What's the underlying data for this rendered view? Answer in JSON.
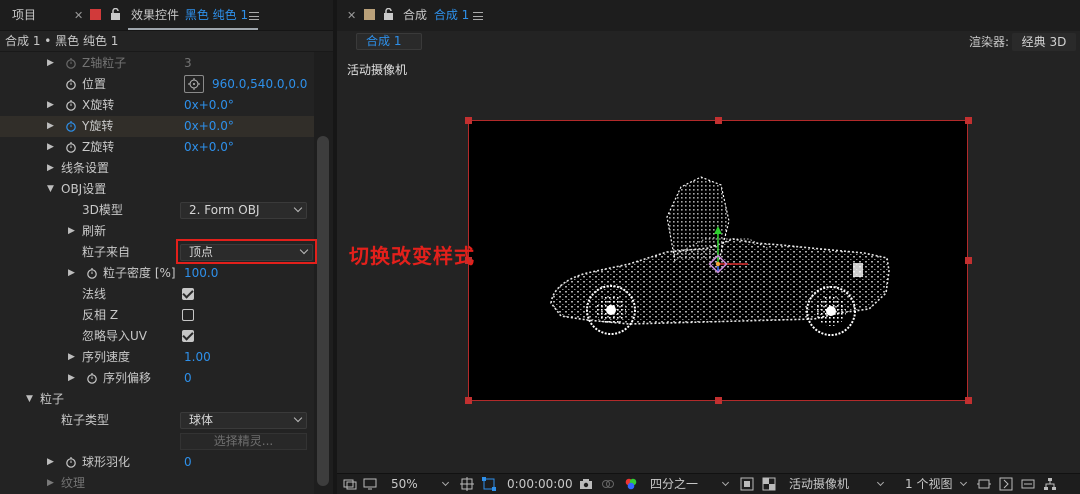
{
  "left_tabs": {
    "project": "项目",
    "effects_prefix": "效果控件",
    "effects_layer": "黑色 纯色 1"
  },
  "left_subheader": "合成 1 • 黑色 纯色 1",
  "properties": [
    {
      "label": "Z轴粒子",
      "value": "3",
      "dim": true
    },
    {
      "label": "位置",
      "value": "960.0,540.0,0.0"
    },
    {
      "label": "X旋转",
      "value": "0x+0.0°"
    },
    {
      "label": "Y旋转",
      "value": "0x+0.0°"
    },
    {
      "label": "Z旋转",
      "value": "0x+0.0°"
    },
    {
      "label": "线条设置"
    },
    {
      "label": "OBJ设置"
    },
    {
      "label": "3D模型",
      "value": "2. Form OBJ"
    },
    {
      "label": "刷新"
    },
    {
      "label": "粒子来自",
      "value": "顶点"
    },
    {
      "label": "粒子密度 [%]",
      "value": "100.0"
    },
    {
      "label": "法线",
      "checked": true
    },
    {
      "label": "反相 Z",
      "checked": false
    },
    {
      "label": "忽略导入UV",
      "checked": true
    },
    {
      "label": "序列速度",
      "value": "1.00"
    },
    {
      "label": "序列偏移",
      "value": "0"
    },
    {
      "label": "粒子"
    },
    {
      "label": "粒子类型",
      "value": "球体"
    },
    {
      "label": "",
      "value": "选择精灵..."
    },
    {
      "label": "球形羽化",
      "value": "0"
    },
    {
      "label": "纹理"
    }
  ],
  "annotation": "切换改变样式",
  "right_tabs": {
    "comp_prefix": "合成",
    "comp_name": "合成 1"
  },
  "comp_pill": "合成 1",
  "renderer_label": "渲染器:",
  "renderer_value": "经典 3D",
  "camera_label": "活动摄像机",
  "bottom_bar": {
    "zoom": "50%",
    "timecode": "0:00:00:00",
    "resolution": "四分之一",
    "camera": "活动摄像机",
    "views": "1 个视图"
  },
  "colors": {
    "accent_blue": "#2e90ea",
    "annotation_red": "#e3201b",
    "label_red": "#d13a3a",
    "label_tan": "#b9a079"
  }
}
